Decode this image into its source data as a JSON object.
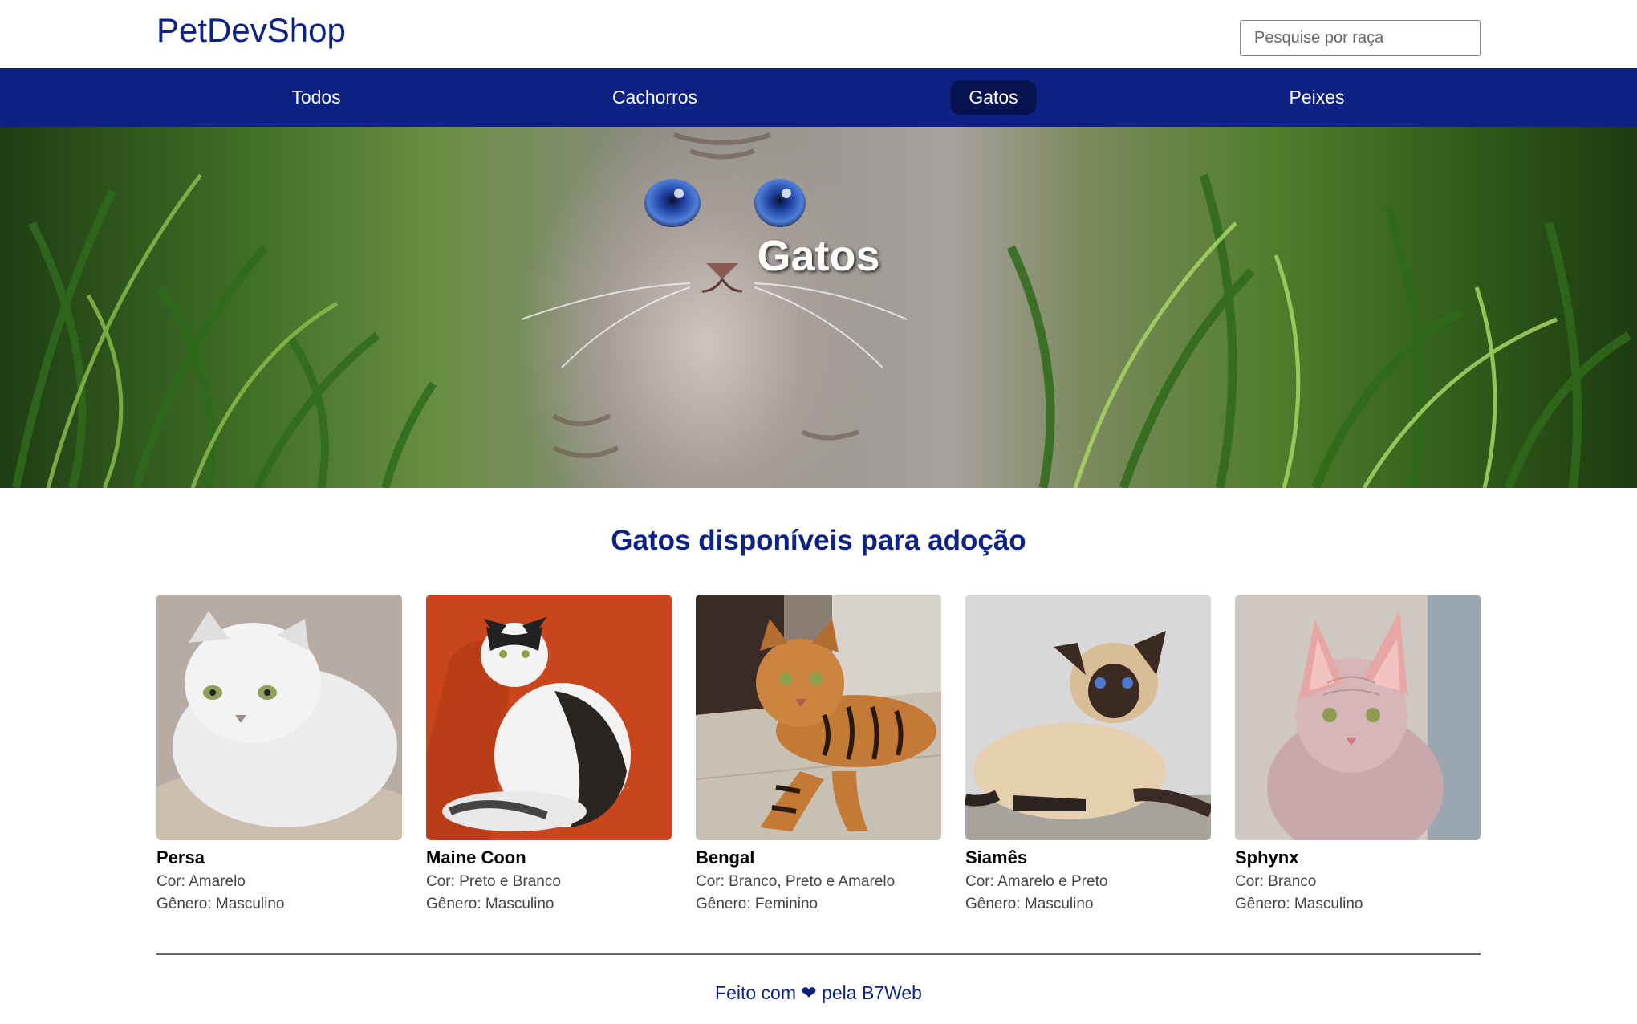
{
  "header": {
    "logo": "PetDevShop",
    "search_placeholder": "Pesquise por raça"
  },
  "nav": {
    "items": [
      {
        "label": "Todos",
        "active": false
      },
      {
        "label": "Cachorros",
        "active": false
      },
      {
        "label": "Gatos",
        "active": true
      },
      {
        "label": "Peixes",
        "active": false
      }
    ]
  },
  "hero": {
    "title": "Gatos"
  },
  "main": {
    "title": "Gatos disponíveis para adoção",
    "pets": [
      {
        "name": "Persa",
        "color": "Cor: Amarelo",
        "gender": "Gênero: Masculino"
      },
      {
        "name": "Maine Coon",
        "color": "Cor: Preto e Branco",
        "gender": "Gênero: Masculino"
      },
      {
        "name": "Bengal",
        "color": "Cor: Branco, Preto e Amarelo",
        "gender": "Gênero: Feminino"
      },
      {
        "name": "Siamês",
        "color": "Cor: Amarelo e Preto",
        "gender": "Gênero: Masculino"
      },
      {
        "name": "Sphynx",
        "color": "Cor: Branco",
        "gender": "Gênero: Masculino"
      }
    ]
  },
  "footer": {
    "prefix": "Feito com",
    "heart": "❤",
    "suffix": "pela B7Web"
  },
  "colors": {
    "brand": "#0d2283",
    "nav_active": "#06134f"
  }
}
